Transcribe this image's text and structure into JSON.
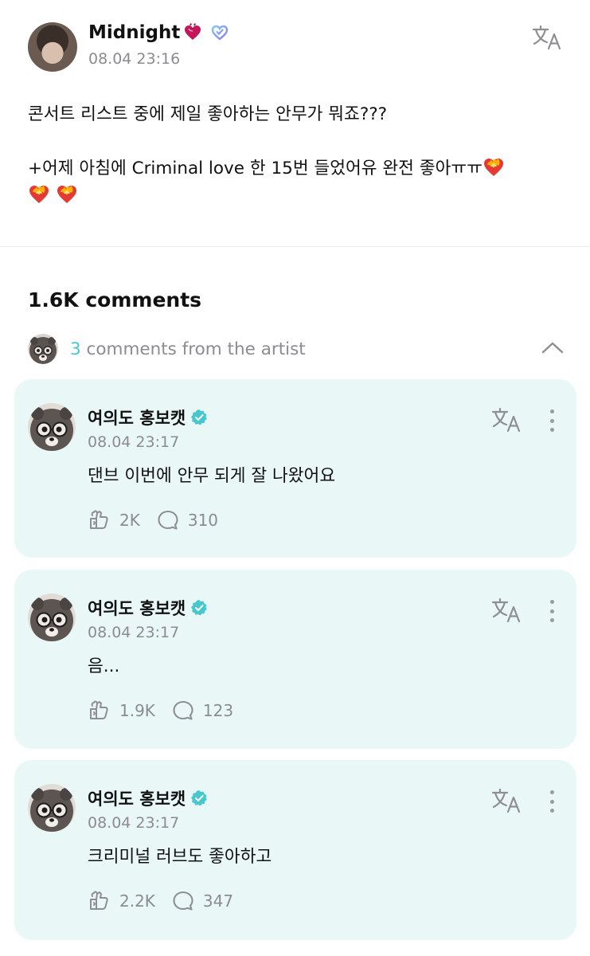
{
  "post": {
    "author_name": "Midnight",
    "time": "08.04 23:16",
    "line1": "콘서트 리스트 중에 제일 좋아하는 안무가 뭐죠???",
    "line2": "+어제 아침에 Criminal love 한 15번 들었어유 완전 좋아ㅠㅠ"
  },
  "comments_count": "1.6K comments",
  "artist_row": {
    "count": "3",
    "label": " comments from the artist"
  },
  "comments": [
    {
      "author": "여의도 홍보캣",
      "time": "08.04 23:17",
      "text": "댄브 이번에 안무 되게 잘 나왔어요",
      "likes": "2K",
      "replies": "310"
    },
    {
      "author": "여의도 홍보캣",
      "time": "08.04 23:17",
      "text": "음...",
      "likes": "1.9K",
      "replies": "123"
    },
    {
      "author": "여의도 홍보캣",
      "time": "08.04 23:17",
      "text": "크리미널 러브도 좋아하고",
      "likes": "2.2K",
      "replies": "347"
    }
  ],
  "colors": {
    "accent": "#48c7cd",
    "card_bg": "#e9f8f7",
    "muted_text": "#8b8b91"
  },
  "icons": [
    "heart-emoji-icon",
    "verified-heart-icon",
    "translate-icon",
    "chevron-up-icon",
    "verified-badge-icon",
    "more-vertical-icon",
    "like-icon",
    "comment-icon",
    "burning-heart-emoji-icon"
  ]
}
